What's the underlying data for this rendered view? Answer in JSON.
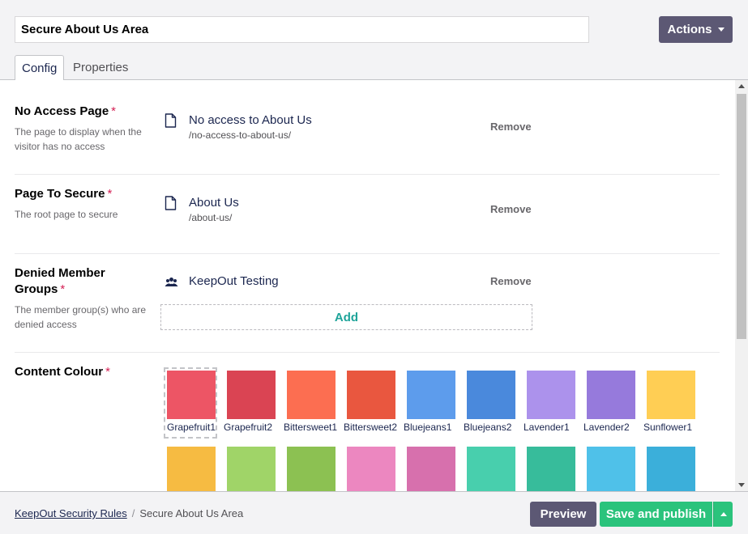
{
  "header": {
    "name_value": "Secure About Us Area",
    "actions_label": "Actions"
  },
  "tabs": [
    {
      "label": "Config"
    },
    {
      "label": "Properties"
    }
  ],
  "properties": {
    "no_access_page": {
      "title": "No Access Page",
      "required_mark": "*",
      "description": "The page to display when the visitor has no access",
      "item": {
        "name": "No access to About Us",
        "url": "/no-access-to-about-us/",
        "icon": "document-icon"
      },
      "remove_label": "Remove"
    },
    "page_to_secure": {
      "title": "Page To Secure",
      "required_mark": "*",
      "description": "The root page to secure",
      "item": {
        "name": "About Us",
        "url": "/about-us/",
        "icon": "document-icon"
      },
      "remove_label": "Remove"
    },
    "denied_member_groups": {
      "title": "Denied Member Groups",
      "required_mark": "*",
      "description": "The member group(s) who are denied access",
      "item": {
        "name": "KeepOut Testing",
        "icon": "member-group-icon"
      },
      "remove_label": "Remove",
      "add_label": "Add"
    },
    "content_colour": {
      "title": "Content Colour",
      "required_mark": "*",
      "selected": "Grapefruit1",
      "swatches": [
        {
          "name": "Grapefruit1",
          "color": "#ed5565"
        },
        {
          "name": "Grapefruit2",
          "color": "#da4453"
        },
        {
          "name": "Bittersweet1",
          "color": "#fc6e51"
        },
        {
          "name": "Bittersweet2",
          "color": "#e9573f"
        },
        {
          "name": "Bluejeans1",
          "color": "#5d9cec"
        },
        {
          "name": "Bluejeans2",
          "color": "#4a89dc"
        },
        {
          "name": "Lavender1",
          "color": "#ac92ec"
        },
        {
          "name": "Lavender2",
          "color": "#967adc"
        },
        {
          "name": "Sunflower1",
          "color": "#ffce54"
        },
        {
          "name": "",
          "color": "#f6bb42"
        },
        {
          "name": "",
          "color": "#a0d468"
        },
        {
          "name": "",
          "color": "#8cc152"
        },
        {
          "name": "",
          "color": "#ec87c0"
        },
        {
          "name": "",
          "color": "#d770ad"
        },
        {
          "name": "",
          "color": "#48cfad"
        },
        {
          "name": "",
          "color": "#37bc9b"
        },
        {
          "name": "",
          "color": "#4fc1e9"
        },
        {
          "name": "",
          "color": "#3bafda"
        }
      ]
    }
  },
  "footer": {
    "breadcrumb_root": "KeepOut Security Rules",
    "breadcrumb_separator": "/",
    "breadcrumb_current": "Secure About Us Area",
    "preview_label": "Preview",
    "publish_label": "Save and publish"
  }
}
